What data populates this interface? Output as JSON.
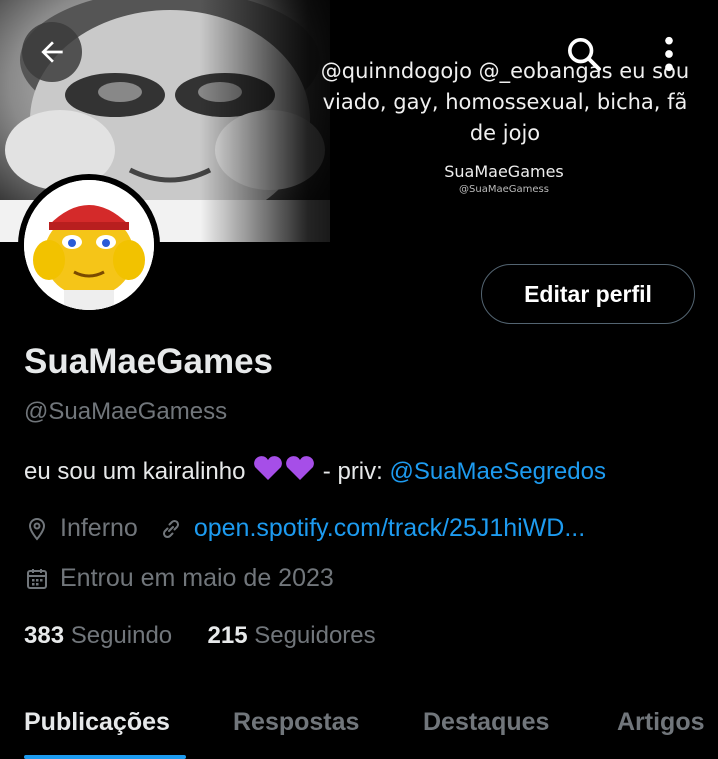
{
  "banner": {
    "caption": "@quinndogojo @_eobangas eu sou viado, gay, homossexual, bicha, fã de jojo",
    "watermark_name": "SuaMaeGames",
    "watermark_handle": "@SuaMaeGamess"
  },
  "icons": {
    "back": "arrow-left-icon",
    "search": "search-icon",
    "more": "more-vertical-icon",
    "location": "location-pin-icon",
    "link": "link-icon",
    "calendar": "calendar-icon"
  },
  "profile": {
    "edit_label": "Editar perfil",
    "display_name": "SuaMaeGames",
    "handle": "@SuaMaeGamess",
    "bio_text": "eu sou um kairalinho ",
    "bio_emoji": "💜💜",
    "bio_suffix": " - priv: ",
    "bio_mention": "@SuaMaeSegredos",
    "location": "Inferno",
    "link": "open.spotify.com/track/25J1hiWD...",
    "joined": "Entrou em maio de 2023",
    "following_count": "383",
    "following_label": "Seguindo",
    "followers_count": "215",
    "followers_label": "Seguidores"
  },
  "tabs": [
    {
      "label": "Publicações",
      "active": true
    },
    {
      "label": "Respostas",
      "active": false
    },
    {
      "label": "Destaques",
      "active": false
    },
    {
      "label": "Artigos",
      "active": false
    }
  ],
  "colors": {
    "background": "#000000",
    "accent": "#1d9bf0",
    "secondary_text": "#71767b",
    "primary_text": "#e7e9ea"
  }
}
